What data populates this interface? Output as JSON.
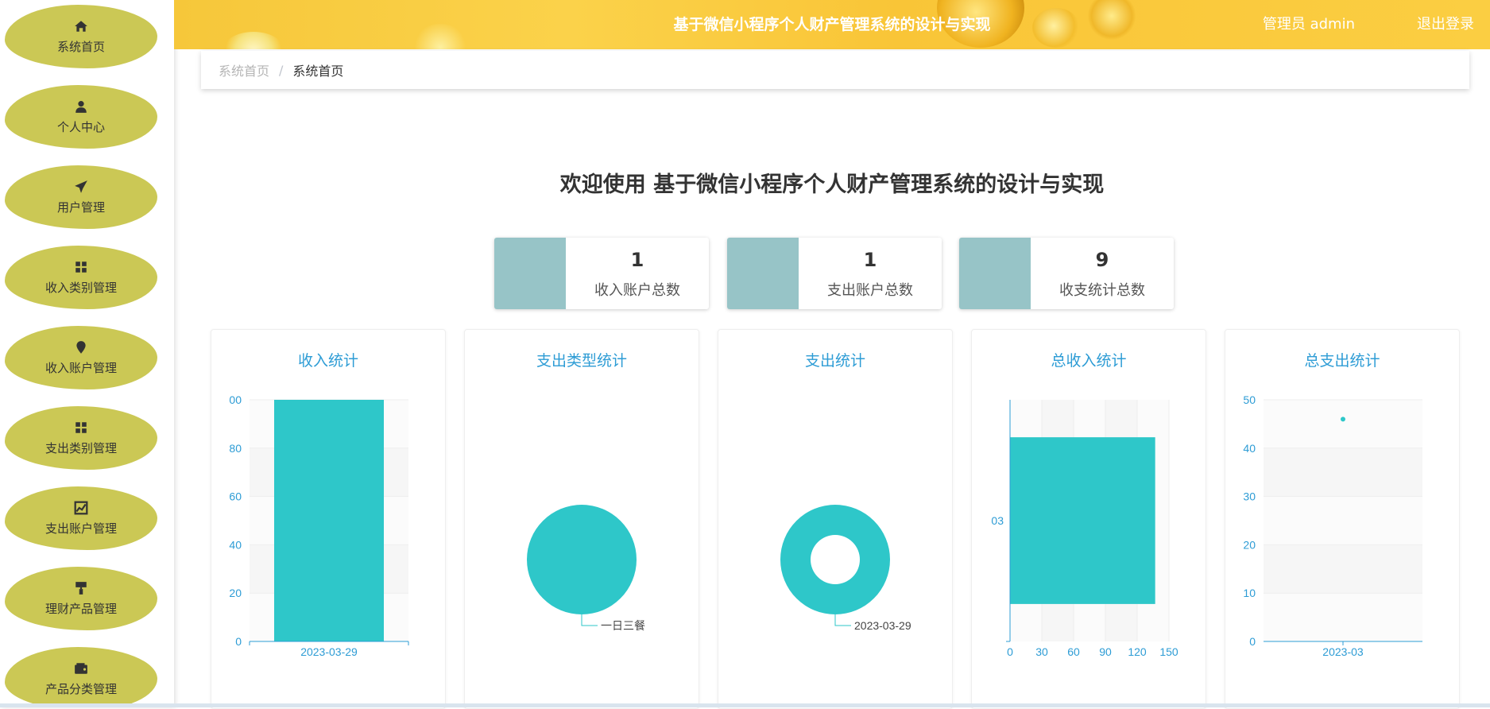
{
  "sidebar": {
    "items": [
      {
        "label": "系统首页",
        "icon": "home-icon"
      },
      {
        "label": "个人中心",
        "icon": "user-icon"
      },
      {
        "label": "用户管理",
        "icon": "paper-plane-icon"
      },
      {
        "label": "收入类别管理",
        "icon": "grid-icon"
      },
      {
        "label": "收入账户管理",
        "icon": "map-pin-icon"
      },
      {
        "label": "支出类别管理",
        "icon": "grid-icon"
      },
      {
        "label": "支出账户管理",
        "icon": "line-chart-icon"
      },
      {
        "label": "理财产品管理",
        "icon": "paint-roller-icon"
      },
      {
        "label": "产品分类管理",
        "icon": "wallet-icon"
      }
    ]
  },
  "header": {
    "title": "基于微信小程序个人财产管理系统的设计与实现",
    "user": "管理员 admin",
    "logout": "退出登录"
  },
  "breadcrumb": {
    "home": "系统首页",
    "separator": "/",
    "current": "系统首页"
  },
  "welcome": "欢迎使用 基于微信小程序个人财产管理系统的设计与实现",
  "stats": [
    {
      "value": "1",
      "label": "收入账户总数"
    },
    {
      "value": "1",
      "label": "支出账户总数"
    },
    {
      "value": "9",
      "label": "收支统计总数"
    }
  ],
  "colors": {
    "sidebar_item": "#cbc855",
    "header": "#f9c537",
    "stat_block": "#97c4c7",
    "chart_teal": "#2ec7c9",
    "chart_text": "#2d9cd5"
  },
  "chart_data": [
    {
      "type": "bar",
      "title": "收入统计",
      "categories": [
        "2023-03-29"
      ],
      "values": [
        100
      ],
      "ylim": [
        0,
        100
      ],
      "yticks": [
        "0",
        "20",
        "40",
        "60",
        "80",
        "00"
      ]
    },
    {
      "type": "pie",
      "title": "支出类型统计",
      "slices": [
        {
          "name": "一日三餐",
          "value": 100
        }
      ]
    },
    {
      "type": "pie",
      "title": "支出统计",
      "donut": true,
      "slices": [
        {
          "name": "2023-03-29",
          "value": 100
        }
      ]
    },
    {
      "type": "bar",
      "orientation": "horizontal",
      "title": "总收入统计",
      "categories": [
        "03"
      ],
      "values": [
        137
      ],
      "xlim": [
        0,
        150
      ],
      "xticks": [
        "0",
        "30",
        "60",
        "90",
        "120",
        "150"
      ]
    },
    {
      "type": "scatter",
      "title": "总支出统计",
      "x": [
        "2023-03"
      ],
      "values": [
        46
      ],
      "ylim": [
        0,
        50
      ],
      "yticks": [
        "0",
        "10",
        "20",
        "30",
        "40",
        "50"
      ]
    }
  ]
}
